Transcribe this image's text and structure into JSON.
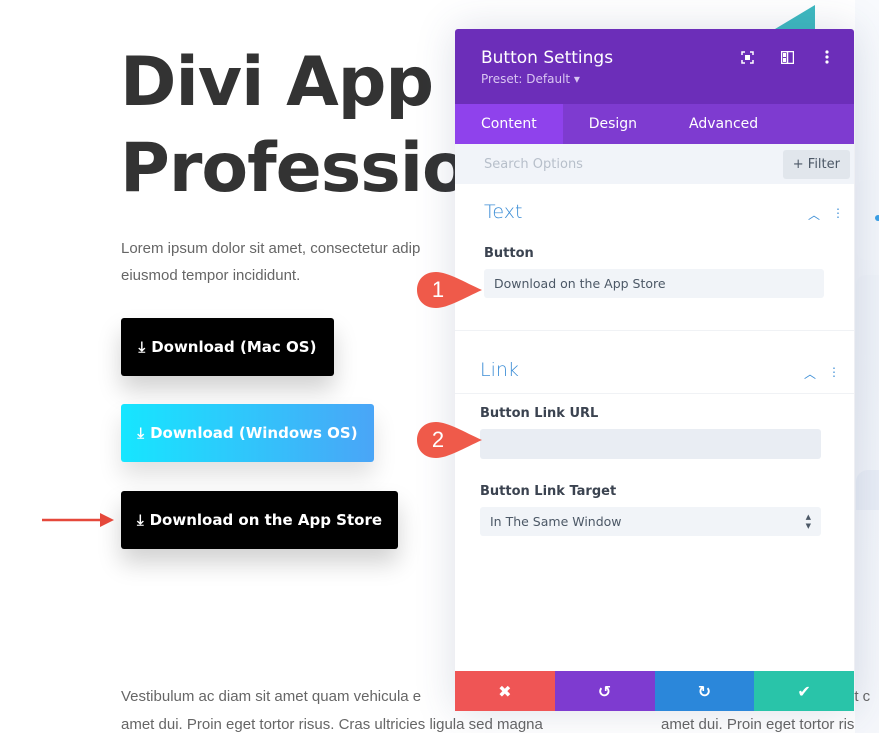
{
  "hero": {
    "title_line1": "Divi App f",
    "title_line2": "Professio",
    "text_line1": "Lorem ipsum dolor sit amet, consectetur adip",
    "text_line2": "eiusmod tempor incididunt."
  },
  "buttons": [
    {
      "label": "Download (Mac OS)",
      "icon": "download-icon"
    },
    {
      "label": "Download (Windows OS)",
      "icon": "download-icon"
    },
    {
      "label": "Download on the App Store",
      "icon": "download-icon"
    }
  ],
  "footer": {
    "left_line1": "Vestibulum ac diam sit amet quam vehicula e",
    "left_line2": "amet dui. Proin eget tortor risus. Cras ultricies ligula sed magna",
    "right_line1": "et c",
    "right_line2": "amet dui. Proin eget tortor ris"
  },
  "modal": {
    "title": "Button Settings",
    "preset": "Preset: Default ▾",
    "header_icons": [
      "fullscreen-icon",
      "split-view-icon",
      "more-options-icon"
    ],
    "tabs": [
      {
        "label": "Content",
        "active": true
      },
      {
        "label": "Design",
        "active": false
      },
      {
        "label": "Advanced",
        "active": false
      }
    ],
    "search_placeholder": "Search Options",
    "filter_label": "+ Filter",
    "sections": {
      "text": {
        "title": "Text",
        "field_label": "Button",
        "field_value": "Download on the App Store"
      },
      "link": {
        "title": "Link",
        "url_label": "Button Link URL",
        "url_value": "",
        "target_label": "Button Link Target",
        "target_value": "In The Same Window"
      }
    },
    "footer_actions": {
      "cancel": "✖",
      "undo": "↺",
      "redo": "↻",
      "save": "✔"
    }
  },
  "callouts": [
    "1",
    "2"
  ],
  "colors": {
    "modal_header": "#6c2eb9",
    "tabs_bg": "#7e3bd0",
    "tab_active": "#8f42ec",
    "section_title": "#3d8ed6",
    "cancel": "#ef5555",
    "undo": "#7e3bd0",
    "redo": "#2b87da",
    "save": "#29c4a9",
    "callout": "#ef5a4a"
  }
}
